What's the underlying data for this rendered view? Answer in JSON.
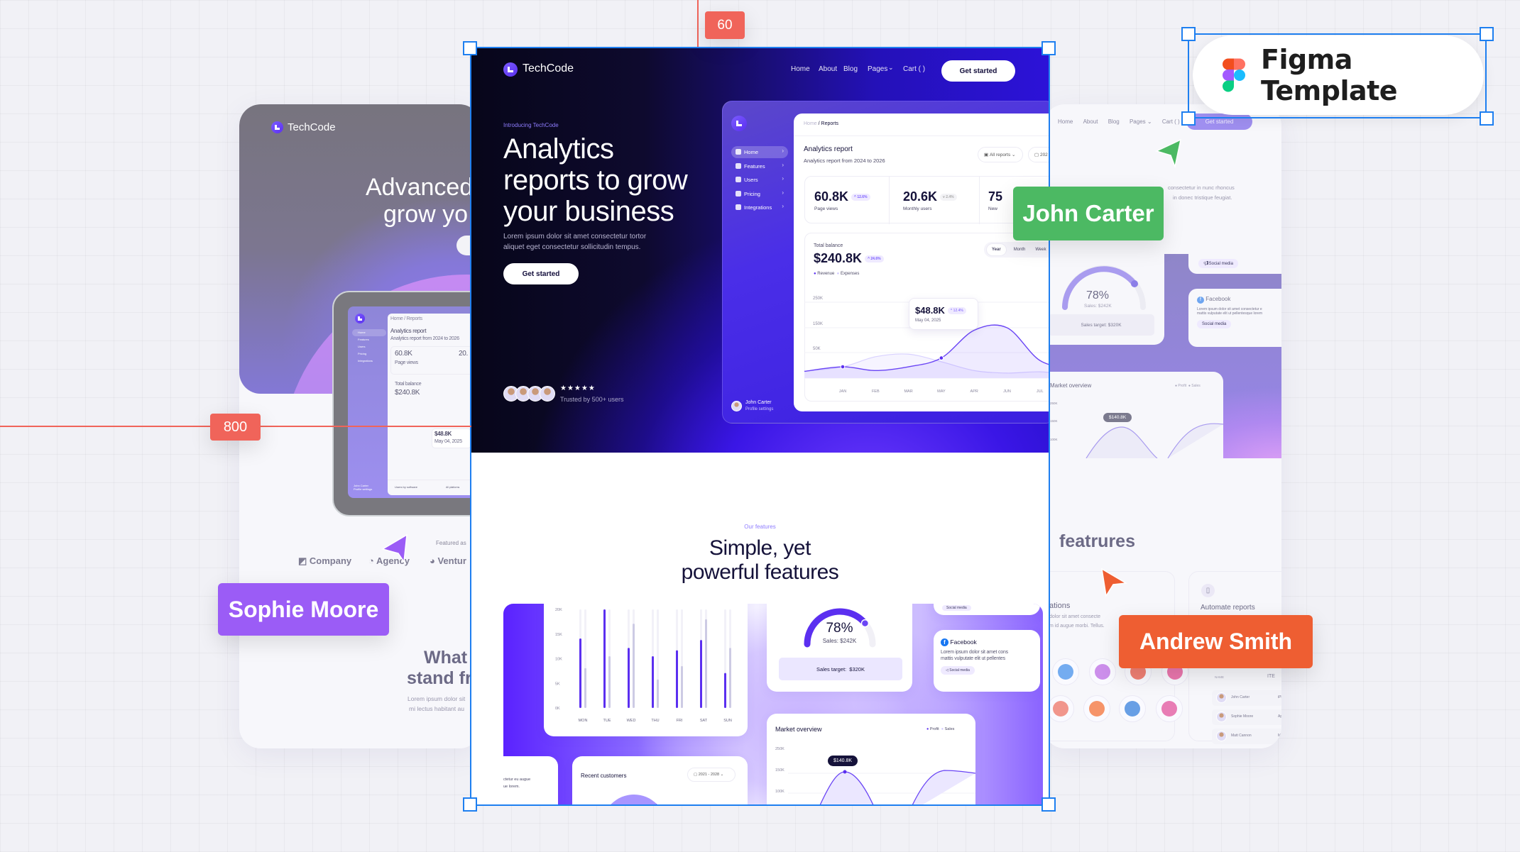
{
  "annotations": {
    "top_marker": "60",
    "left_marker": "800",
    "figma_badge": "Figma Template",
    "cursors": [
      {
        "name": "John Carter",
        "color": "#4cb963"
      },
      {
        "name": "Sophie Moore",
        "color": "#9b5cf6"
      },
      {
        "name": "Andrew Smith",
        "color": "#ee5e32"
      }
    ],
    "guide_color": "#f0645a",
    "selection_color": "#1e7ff0"
  },
  "left_card": {
    "brand": "TechCode",
    "headline": [
      "Advanced",
      "grow yo"
    ],
    "featured_as": "Featured as",
    "logos": [
      "Company",
      "Agency",
      "Ventur"
    ],
    "section_title": [
      "What",
      "stand fr"
    ],
    "section_text": [
      "Lorem ipsum dolor sit",
      "mi lectus habitant au"
    ],
    "tablet": {
      "breadcrumb": "Home / Reports",
      "title": "Analytics report",
      "subtitle": "Analytics report from 2024 to 2026",
      "stat1": "60.8K",
      "stat1_label": "Page views",
      "stat2": "20.",
      "balance_label": "Total balance",
      "balance": "$240.8K",
      "nav": [
        "Home",
        "Features",
        "Users",
        "Pricing",
        "Integrations"
      ],
      "user": "John Carter",
      "user_sub": "Profile settings",
      "bottom": "Users by software",
      "bottom_pill": "All platforms",
      "tooltip": "$48.8K",
      "tooltip_date": "May 04, 2025"
    }
  },
  "right_card": {
    "nav": [
      "Home",
      "About",
      "Blog",
      "Pages",
      "Cart ( )"
    ],
    "cta": "Get started",
    "text": [
      "consectetur in nunc rhoncus",
      "in donec tristique feugiat."
    ],
    "gauge": {
      "value": "78%",
      "sales": "Sales: $242K",
      "target": "Sales target:  $320K"
    },
    "social_chip": "Social media",
    "facebook": {
      "title": "Facebook",
      "text": [
        "Lorem ipsum dolor sit amet consectetur e",
        "mattis vulputate elit ut pellentesque lorem"
      ]
    },
    "market": {
      "title": "Market overview",
      "legend": [
        "Profit",
        "Sales"
      ],
      "ticks": [
        "250K",
        "150K",
        "100K"
      ],
      "tooltip": "$140.8K"
    },
    "features_heading": "featrures",
    "card1": {
      "title": "ations",
      "text": [
        "dolor sit amet consecte",
        "m id augue morbi. Tellus."
      ]
    },
    "card2": {
      "title": "Automate reports",
      "table_header": [
        "NAME",
        "ITE"
      ],
      "rows": [
        [
          "John Carter",
          "iPh"
        ],
        [
          "Sophie Moore",
          "App"
        ],
        [
          "Matt Cannon",
          "Ma"
        ]
      ]
    },
    "integration_colors": [
      "#5c9ded",
      "#c37be8",
      "#ee6a5c",
      "#e85fa0",
      "#ee8478",
      "#f4814f",
      "#4d8ee0",
      "#e466a8"
    ]
  },
  "main": {
    "brand": "TechCode",
    "nav": [
      "Home",
      "About",
      "Blog",
      "Pages",
      "Cart ( )"
    ],
    "cta": "Get started",
    "eyebrow": "Introducing TechCode",
    "headline": [
      "Analytics",
      "reports to grow",
      "your business"
    ],
    "paragraph": [
      "Lorem ipsum dolor sit amet consectetur tortor",
      "aliquet eget consectetur sollicitudin tempus."
    ],
    "hero_button": "Get started",
    "rating_stars": 5,
    "trusted": "Trusted by 500+ users",
    "dashboard": {
      "sidebar": [
        "Home",
        "Features",
        "Users",
        "Pricing",
        "Integrations"
      ],
      "active": "Home",
      "user": "John Carter",
      "user_sub": "Profile settings",
      "breadcrumb_home": "Home",
      "breadcrumb_sep": "/",
      "breadcrumb_current": "Reports",
      "title": "Analytics report",
      "subtitle": "Analytics report from 2024 to 2026",
      "filter": "All reports",
      "date_pill": "202",
      "stats": [
        {
          "value": "60.8K",
          "change": "^ 12.6%",
          "label": "Page views"
        },
        {
          "value": "20.6K",
          "change": "v 2.4%",
          "label": "Monthly users"
        },
        {
          "value": "75",
          "label": "New"
        }
      ],
      "balance_label": "Total balance",
      "balance": "$240.8K",
      "balance_change": "^ 24.6%",
      "legend": [
        "Revenue",
        "Expenses"
      ],
      "toggle": [
        "Year",
        "Month",
        "Week"
      ],
      "toggle_active": "Year",
      "chart": {
        "y_ticks": [
          "250K",
          "150K",
          "50K",
          "0K"
        ],
        "categories": [
          "JAN",
          "FEB",
          "MAR",
          "MAY",
          "APR",
          "JUN",
          "JUL"
        ],
        "revenue_k": [
          45,
          30,
          45,
          80,
          190,
          200,
          70
        ],
        "expenses_k": [
          45,
          85,
          95,
          65,
          30,
          20,
          25
        ],
        "highlight_index": 3
      },
      "tooltip": {
        "value": "$48.8K",
        "change": "^ 12.4%",
        "date": "May 04, 2025"
      }
    },
    "features": {
      "eyebrow": "Our features",
      "title": [
        "Simple, yet",
        "powerful features"
      ],
      "bar_chart": {
        "y_ticks": [
          "20K",
          "15K",
          "10K",
          "5K",
          "0K"
        ],
        "categories": [
          "MON",
          "TUE",
          "WED",
          "THU",
          "FRI",
          "SAT",
          "SUN"
        ],
        "primary_k": [
          14.1,
          20,
          12.2,
          10.5,
          11.7,
          13.8,
          7.1
        ],
        "secondary_k": [
          8.1,
          10.5,
          17.1,
          5.8,
          8.5,
          18,
          12.2
        ],
        "max_k": 20
      },
      "gauge": {
        "value": "78%",
        "fraction": 0.78,
        "sales": "Sales: $242K",
        "target": "Sales target:  $320K"
      },
      "social_chip": "Social media",
      "facebook": {
        "title": "Facebook",
        "text": [
          "Lorem ipsum dolor sit amet cons",
          "mattis vulputate elit ut pellentes"
        ],
        "chip": "Social media"
      },
      "market": {
        "title": "Market overview",
        "legend": [
          "Profit",
          "Sales"
        ],
        "ticks": [
          "250K",
          "150K",
          "100K"
        ],
        "tooltip": "$140.8K"
      },
      "recent": {
        "title": "Recent customers",
        "range": "2021 - 2028"
      },
      "side_text": [
        "ctetur eu augue",
        "ue lorem."
      ]
    },
    "colors": {
      "accent": "#5b2ff0",
      "navy": "#15123a",
      "hero_dark": "#07061a"
    }
  }
}
